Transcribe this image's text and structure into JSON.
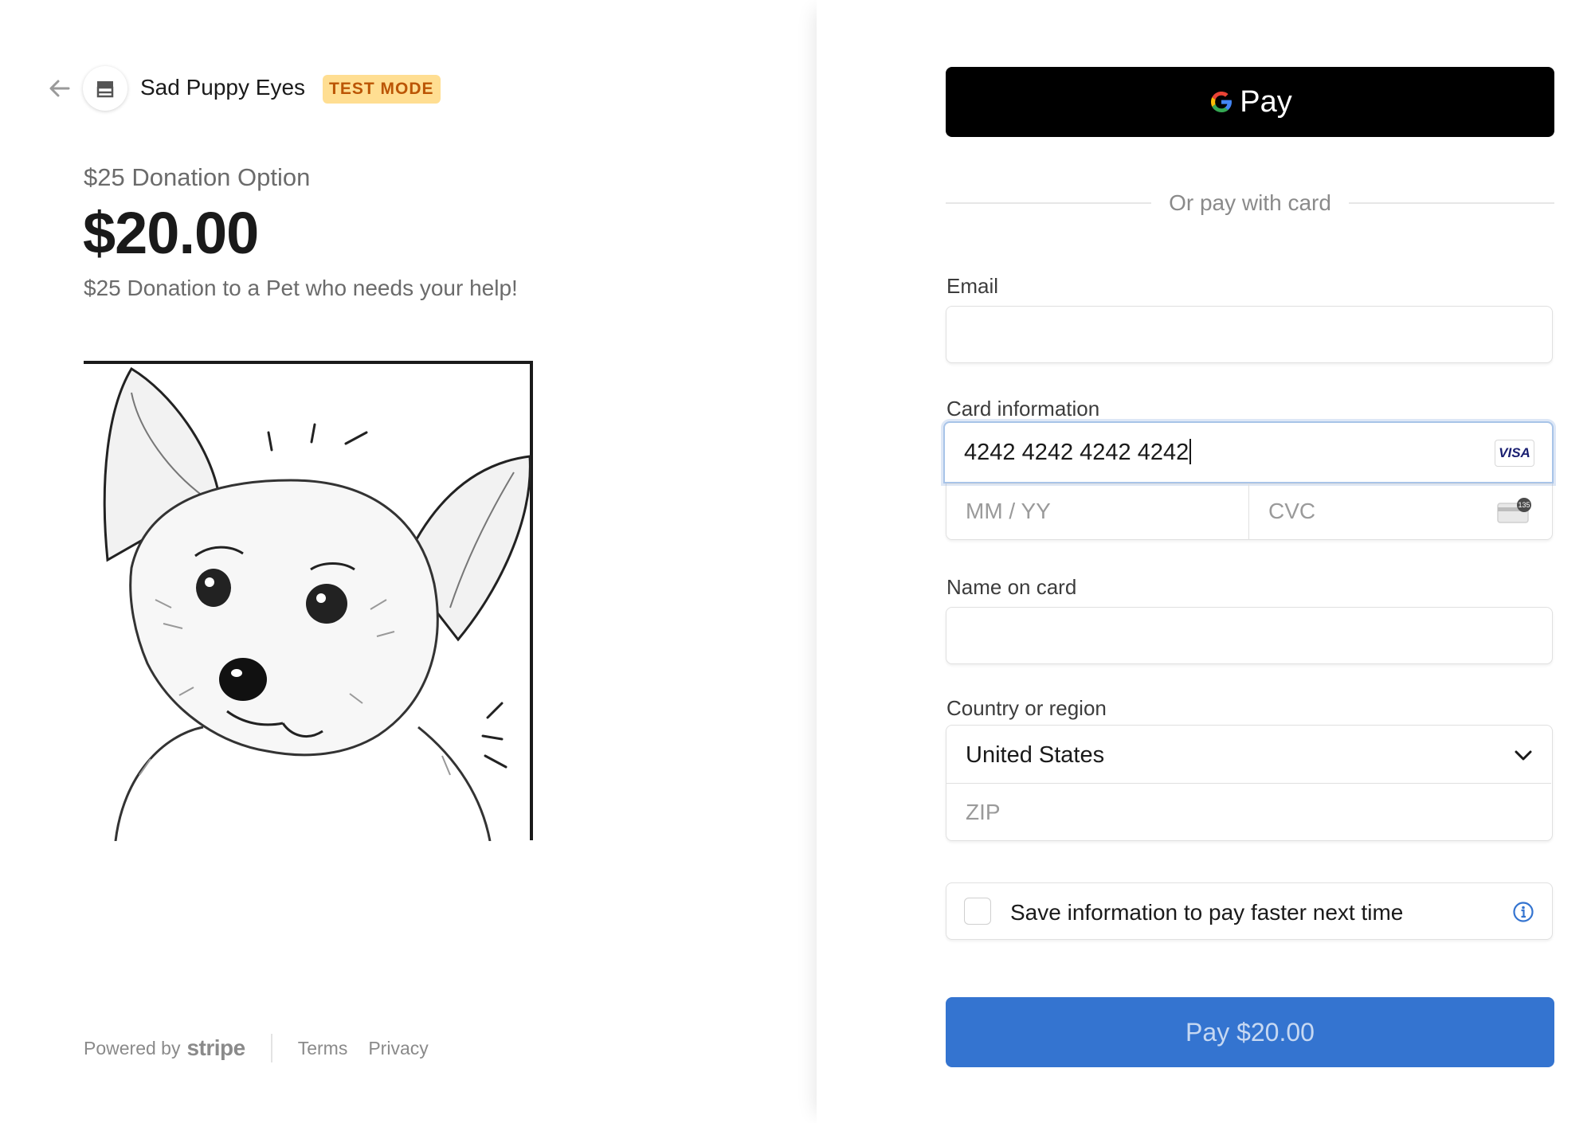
{
  "merchant": {
    "name": "Sad Puppy Eyes",
    "mode_badge": "TEST MODE"
  },
  "product": {
    "name": "$25 Donation Option",
    "price": "$20.00",
    "description": "$25 Donation to a Pet who needs your help!"
  },
  "footer": {
    "powered_by": "Powered by",
    "brand": "stripe",
    "terms": "Terms",
    "privacy": "Privacy"
  },
  "wallet": {
    "gpay_label": "Pay",
    "or_text": "Or pay with card"
  },
  "form": {
    "email": {
      "label": "Email",
      "value": ""
    },
    "card": {
      "label": "Card information",
      "number": "4242 4242 4242 4242",
      "brand_badge": "VISA",
      "expiry_placeholder": "MM / YY",
      "cvc_placeholder": "CVC",
      "cvc_icon_digits": "135"
    },
    "name_on_card": {
      "label": "Name on card",
      "value": ""
    },
    "country": {
      "label": "Country or region",
      "selected": "United States",
      "zip_placeholder": "ZIP"
    },
    "save_info": {
      "label": "Save information to pay faster next time",
      "checked": false
    }
  },
  "pay_button": {
    "label": "Pay $20.00"
  },
  "colors": {
    "accent": "#3474d0",
    "badge_bg": "#ffde92",
    "badge_text": "#bb5504",
    "gpay_bg": "#000000"
  }
}
